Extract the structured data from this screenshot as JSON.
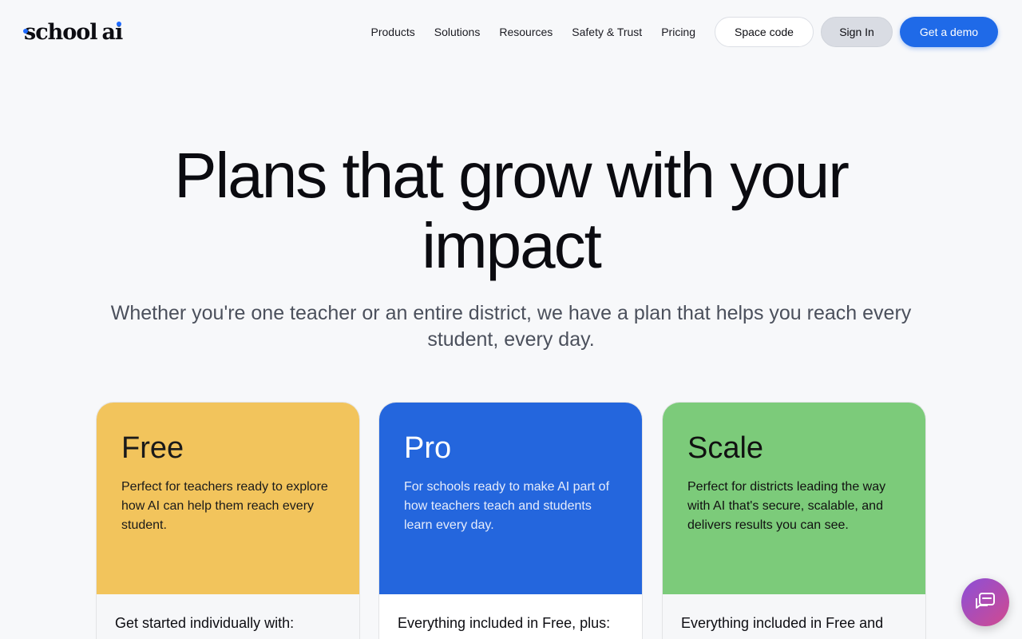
{
  "brand": {
    "logo_text": "schoolai",
    "logo_part1": "school",
    "logo_part2": "ai",
    "accent": "#1f6bff"
  },
  "nav": {
    "items": [
      {
        "label": "Products"
      },
      {
        "label": "Solutions"
      },
      {
        "label": "Resources"
      },
      {
        "label": "Safety & Trust"
      },
      {
        "label": "Pricing"
      }
    ],
    "space_code_label": "Space code",
    "sign_in_label": "Sign In",
    "demo_label": "Get a demo"
  },
  "hero": {
    "title_line1": "Plans that grow with your",
    "title_line2": "impact",
    "subtitle_line1": "Whether you're one teacher or an entire district, we have a plan that helps you reach every",
    "subtitle_line2": "student, every day."
  },
  "plans": [
    {
      "name": "Free",
      "description": "Perfect for teachers ready to explore how AI can help them reach every student.",
      "features_heading": "Get started individually with:",
      "color": "#f2c45c"
    },
    {
      "name": "Pro",
      "description": "For schools ready to make AI part of how teachers teach and students learn every day.",
      "features_heading": "Everything included in Free, plus:",
      "color": "#2466dd"
    },
    {
      "name": "Scale",
      "description": "Perfect for districts leading the way with AI that's secure, scalable, and delivers results you can see.",
      "features_heading": "Everything included in Free and",
      "color": "#7ccb7a"
    }
  ],
  "chat": {
    "icon": "chat-icon"
  }
}
